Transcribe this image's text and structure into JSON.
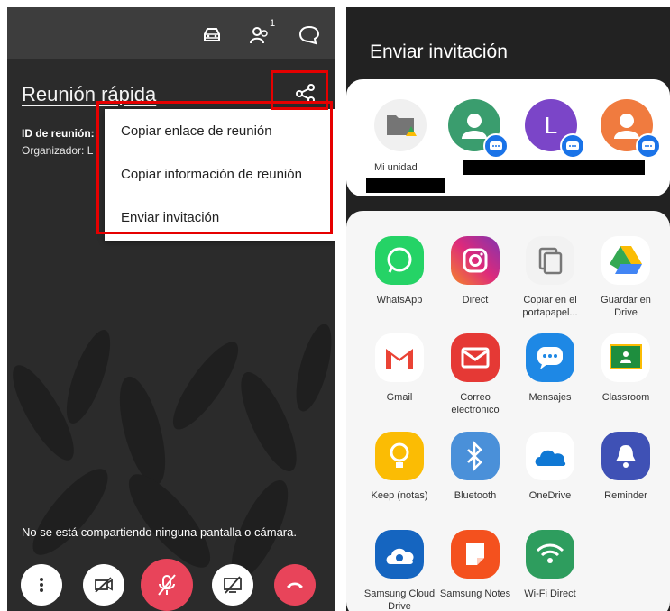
{
  "left": {
    "title": "Reunión rápida",
    "meeting_id_label": "ID de reunión: ",
    "organizer_label": "Organizador: L",
    "participant_count": "1",
    "menu": [
      "Copiar enlace de reunión",
      "Copiar información de reunión",
      "Enviar invitación"
    ],
    "status": "No se está compartiendo ninguna pantalla o cámara."
  },
  "right": {
    "title": "Enviar invitación",
    "contacts": [
      {
        "label": "Mi unidad",
        "icon": "drive-folder-icon",
        "color": "#f0f0f0"
      },
      {
        "label": "",
        "icon": "person-icon",
        "color": "#3a9d6e"
      },
      {
        "label": "",
        "icon": "letter-avatar",
        "initial": "L",
        "color": "#7b45c8"
      },
      {
        "label": "",
        "icon": "person-icon",
        "color": "#f07b3f"
      }
    ],
    "apps": [
      {
        "label": "WhatsApp",
        "icon": "whatsapp-icon",
        "color": "#25d366"
      },
      {
        "label": "Direct",
        "icon": "instagram-icon",
        "color": "#c13584"
      },
      {
        "label": "Copiar en el portapapel...",
        "icon": "copy-icon",
        "color": "#f2f2f2"
      },
      {
        "label": "Guardar en Drive",
        "icon": "drive-icon",
        "color": "#ffffff"
      },
      {
        "label": "Gmail",
        "icon": "gmail-icon",
        "color": "#ffffff"
      },
      {
        "label": "Correo electrónico",
        "icon": "mail-icon",
        "color": "#e53935"
      },
      {
        "label": "Mensajes",
        "icon": "messages-icon",
        "color": "#1e88e5"
      },
      {
        "label": "Classroom",
        "icon": "classroom-icon",
        "color": "#ffffff"
      },
      {
        "label": "Keep (notas)",
        "icon": "keep-icon",
        "color": "#fbbc04"
      },
      {
        "label": "Bluetooth",
        "icon": "bluetooth-icon",
        "color": "#4a90d9"
      },
      {
        "label": "OneDrive",
        "icon": "onedrive-icon",
        "color": "#ffffff"
      },
      {
        "label": "Reminder",
        "icon": "bell-icon",
        "color": "#3f51b5"
      },
      {
        "label": "Samsung Cloud Drive",
        "icon": "cloud-drive-icon",
        "color": "#1565c0"
      },
      {
        "label": "Samsung Notes",
        "icon": "notes-icon",
        "color": "#f4511e"
      },
      {
        "label": "Wi-Fi Direct",
        "icon": "wifi-direct-icon",
        "color": "#2e9d5e"
      }
    ]
  }
}
